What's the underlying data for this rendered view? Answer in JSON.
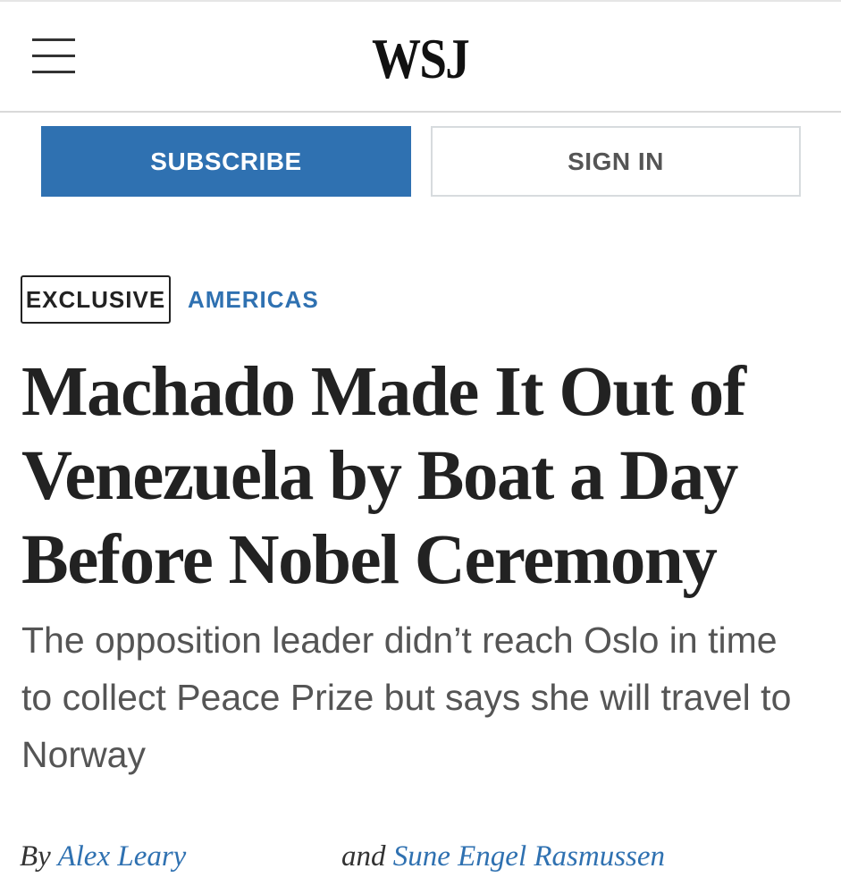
{
  "header": {
    "menu_icon": "hamburger-menu-icon",
    "logo_text": "WSJ"
  },
  "actions": {
    "subscribe_label": "SUBSCRIBE",
    "sign_in_label": "SIGN IN"
  },
  "article": {
    "flag": "EXCLUSIVE",
    "section": "AMERICAS",
    "headline": "Machado Made It Out of Venezuela by Boat a Day Before Nobel Ceremony",
    "dek": "The opposition leader didn’t reach Oslo in time to collect Peace Prize but says she will travel to Norway",
    "byline": {
      "by_prefix": "By",
      "author_1": "Alex Leary",
      "and_word": "and",
      "author_2": "Sune Engel Rasmussen"
    }
  },
  "colors": {
    "accent_blue": "#2f71b1",
    "text_dark": "#222222",
    "text_grey": "#555555"
  }
}
